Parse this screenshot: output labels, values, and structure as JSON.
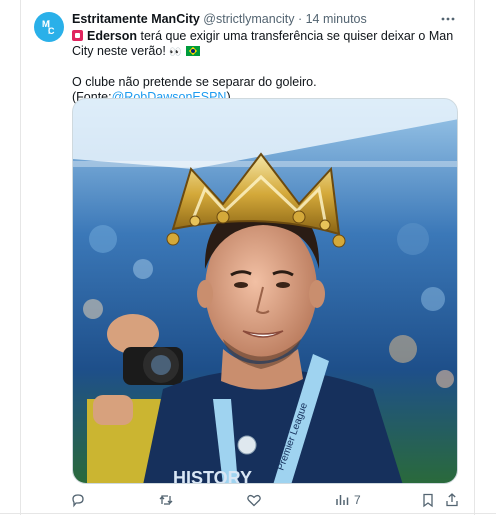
{
  "tweet": {
    "author_name": "Estritamente ManCity",
    "author_handle": "@strictlymancity",
    "separator": "·",
    "timestamp": "14 minutos",
    "line1_bold": "Ederson",
    "line1_rest": " terá que exigir uma transferência se quiser deixar o Man City neste verão! ",
    "line2_prefix": "O clube não pretende se separar do goleiro. (Fonte:",
    "line2_mention": "@RobDawsonESPN",
    "line2_suffix": ")",
    "avatar_icon": "mancity-logo-icon",
    "inline_icons": [
      "red-flag-emoji",
      "eyes-emoji",
      "brazil-flag-emoji"
    ]
  },
  "actions": {
    "reply": {
      "icon": "reply-icon"
    },
    "retweet": {
      "icon": "retweet-icon"
    },
    "like": {
      "icon": "heart-icon"
    },
    "views": {
      "icon": "views-icon",
      "count": "7"
    },
    "bookmark": {
      "icon": "bookmark-icon"
    },
    "share": {
      "icon": "share-icon"
    }
  },
  "colors": {
    "accent": "#1d9bf0",
    "avatar_bg": "#2ab0e9",
    "text": "#0f1419",
    "muted": "#536471"
  }
}
